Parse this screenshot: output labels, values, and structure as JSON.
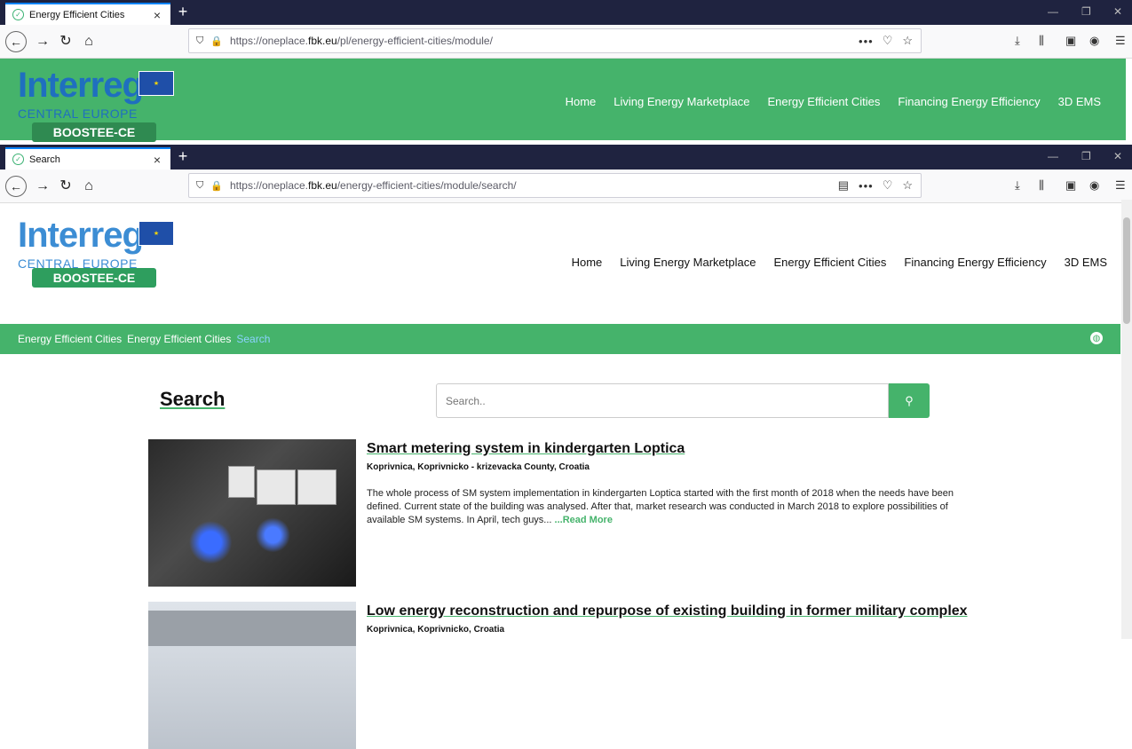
{
  "window1": {
    "tab_title": "Energy Efficient Cities",
    "url_prefix": "https://oneplace.",
    "url_host": "fbk.eu",
    "url_path": "/pl/energy-efficient-cities/module/"
  },
  "window2": {
    "tab_title": "Search",
    "url_prefix": "https://oneplace.",
    "url_host": "fbk.eu",
    "url_path": "/energy-efficient-cities/module/search/"
  },
  "logo": {
    "interreg": "Interreg",
    "central_europe": "CENTRAL EUROPE",
    "eu_small": "European Union European Regional Development Fund",
    "boostee": "BOOSTEE-CE"
  },
  "nav": [
    "Home",
    "Living Energy Marketplace",
    "Energy Efficient Cities",
    "Financing Energy Efficiency",
    "3D EMS"
  ],
  "breadcrumb": [
    "Energy Efficient Cities",
    "Energy Efficient Cities",
    "Search"
  ],
  "search": {
    "title": "Search",
    "placeholder": "Search.."
  },
  "results": [
    {
      "title": "Smart metering system in kindergarten Loptica",
      "location": "Koprivnica, Koprivnicko - krizevacka County, Croatia",
      "description": "The whole process of SM system implementation in kindergarten Loptica started with the first month of 2018 when the needs have been defined. Current state of the building was analysed. After that, market research was conducted in March 2018 to explore possibilities of available SM systems. In April, tech guys...",
      "read_more": "...Read More"
    },
    {
      "title": "Low energy reconstruction and repurpose of existing building in former military complex",
      "location": "Koprivnica, Koprivnicko, Croatia"
    }
  ],
  "colors": {
    "green": "#45b36b",
    "link_blue": "#8bd3ff",
    "tabbar": "#1f2340"
  }
}
